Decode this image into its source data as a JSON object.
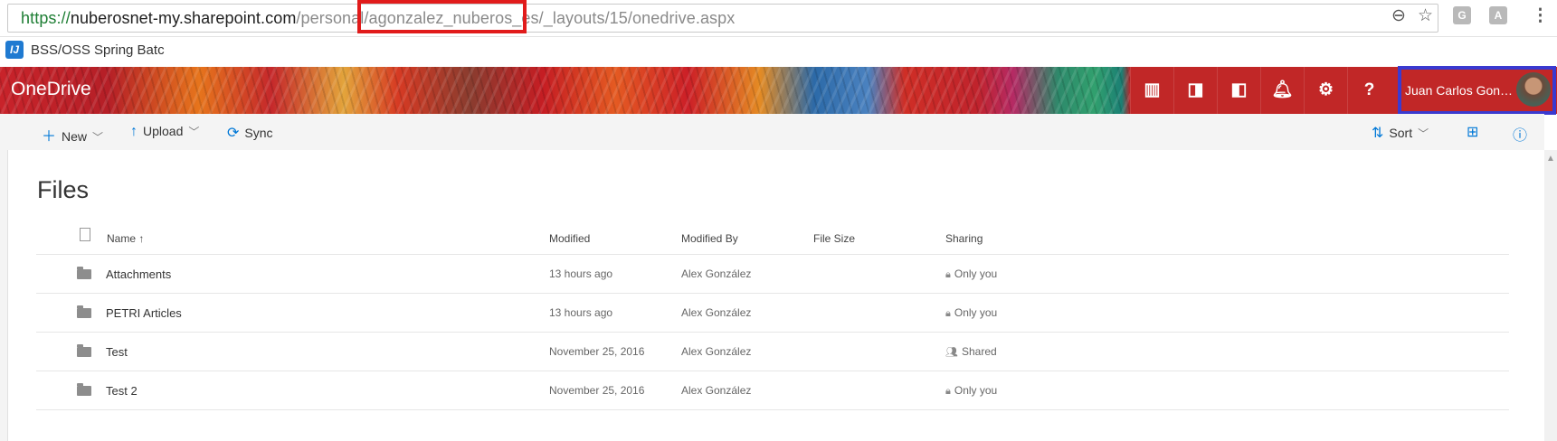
{
  "browser": {
    "url_scheme": "https://",
    "url_host": "nuberosnet-my.sharepoint.com",
    "url_path_1": "/personal/",
    "url_highlight": "agonzalez_nuberos_es/",
    "url_path_2": "_layouts/15/onedrive.aspx",
    "zoom_icon": "zoom-out-icon",
    "star_icon": "bookmark-star-icon",
    "menu_icon": "kebab-menu-icon"
  },
  "bookmarks": [
    {
      "label": "BSS/OSS Spring Batc",
      "icon": "intellij-icon"
    }
  ],
  "suitebar": {
    "brand": "OneDrive",
    "user_name": "Juan Carlos Gon…",
    "help_label": "?",
    "buttons": [
      "powerbi-icon",
      "outlook-icon",
      "office-icon",
      "bell-icon",
      "gear-icon",
      "help-icon"
    ]
  },
  "commands": {
    "new": "New",
    "upload": "Upload",
    "sync": "Sync",
    "sort": "Sort"
  },
  "page": {
    "title": "Files"
  },
  "table": {
    "headers": {
      "name": "Name ↑",
      "modified": "Modified",
      "modified_by": "Modified By",
      "file_size": "File Size",
      "sharing": "Sharing"
    },
    "rows": [
      {
        "name": "Attachments",
        "modified": "13 hours ago",
        "modified_by": "Alex González",
        "file_size": "",
        "sharing": "Only you",
        "type": "folder"
      },
      {
        "name": "PETRI Articles",
        "modified": "13 hours ago",
        "modified_by": "Alex González",
        "file_size": "",
        "sharing": "Only you",
        "type": "folder"
      },
      {
        "name": "Test",
        "modified": "November 25, 2016",
        "modified_by": "Alex González",
        "file_size": "",
        "sharing": "Shared",
        "type": "shared-folder"
      },
      {
        "name": "Test 2",
        "modified": "November 25, 2016",
        "modified_by": "Alex González",
        "file_size": "",
        "sharing": "Only you",
        "type": "folder"
      }
    ]
  },
  "colors": {
    "highlight_red": "#e11b1b",
    "highlight_blue": "#3a3ad0",
    "suite_red": "#c12727",
    "accent": "#0078d7"
  }
}
